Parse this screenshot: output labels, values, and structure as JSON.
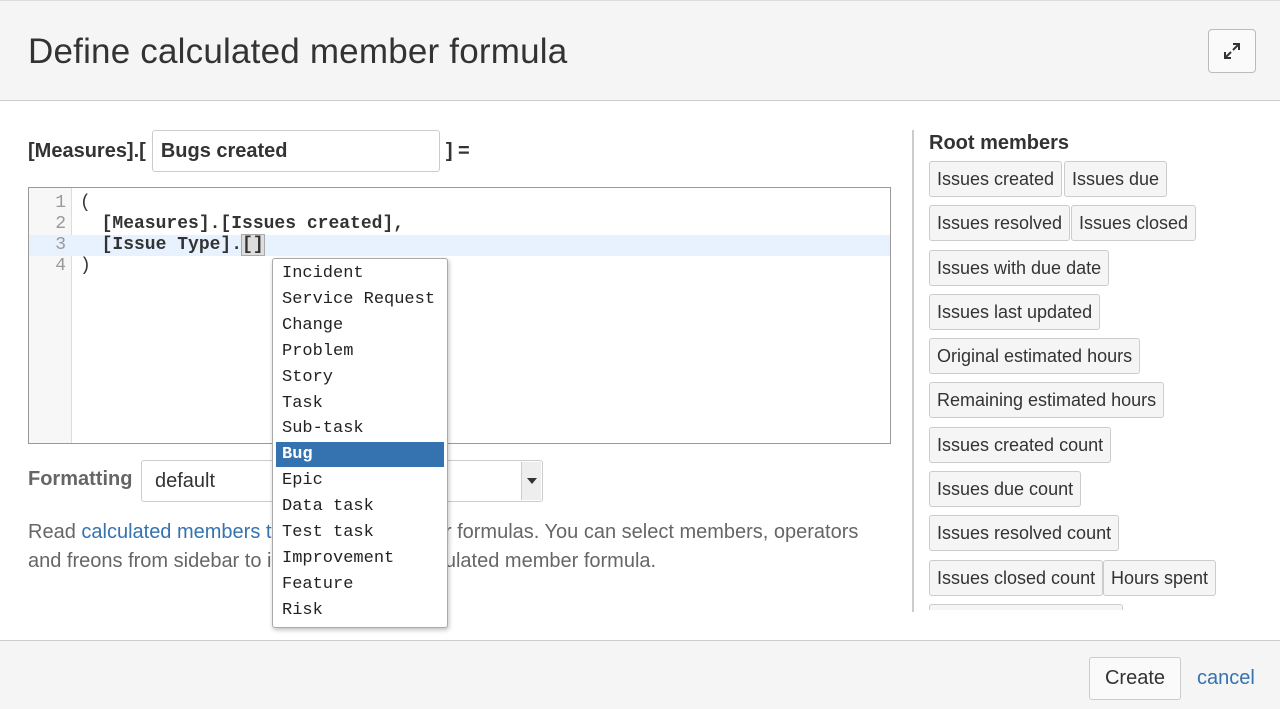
{
  "dialog": {
    "title": "Define calculated member formula"
  },
  "name_row": {
    "prefix": "[Measures].[",
    "value": "Bugs created",
    "suffix": "] ="
  },
  "editor": {
    "lines": [
      {
        "num": "1",
        "code": "("
      },
      {
        "num": "2",
        "code": "  [Measures].[Issues created],"
      },
      {
        "num": "3",
        "code_before": "  [Issue Type].",
        "code_highlight": "[]"
      },
      {
        "num": "4",
        "code": ")"
      }
    ]
  },
  "autocomplete": {
    "items": [
      "Incident",
      "Service Request",
      "Change",
      "Problem",
      "Story",
      "Task",
      "Sub-task",
      "Bug",
      "Epic",
      "Data task",
      "Test task",
      "Improvement",
      "Feature",
      "Risk"
    ],
    "selected": "Bug"
  },
  "formatting": {
    "label": "Formatting",
    "selected": "default"
  },
  "help": {
    "text_before": "Read ",
    "link": "calculated members t",
    "text_mid": "t calculated member formulas. You can select members, operators and fre",
    "text_after": "ons from sidebar to insert them into calculated member formula."
  },
  "sidebar": {
    "title": "Root members",
    "members": [
      "Issues created",
      "Issues due",
      "Issues resolved",
      "Issues closed",
      "Issues with due date",
      "Issues last updated",
      "Original estimated hours",
      "Remaining estimated hours",
      "Issues created count",
      "Issues due count",
      "Issues resolved count",
      "Issues closed count",
      "Hours spent"
    ]
  },
  "footer": {
    "create_label": "Create",
    "cancel_label": "cancel"
  },
  "icons": {
    "expand": "expand-icon",
    "dropdown_arrow": "caret-down-icon"
  }
}
